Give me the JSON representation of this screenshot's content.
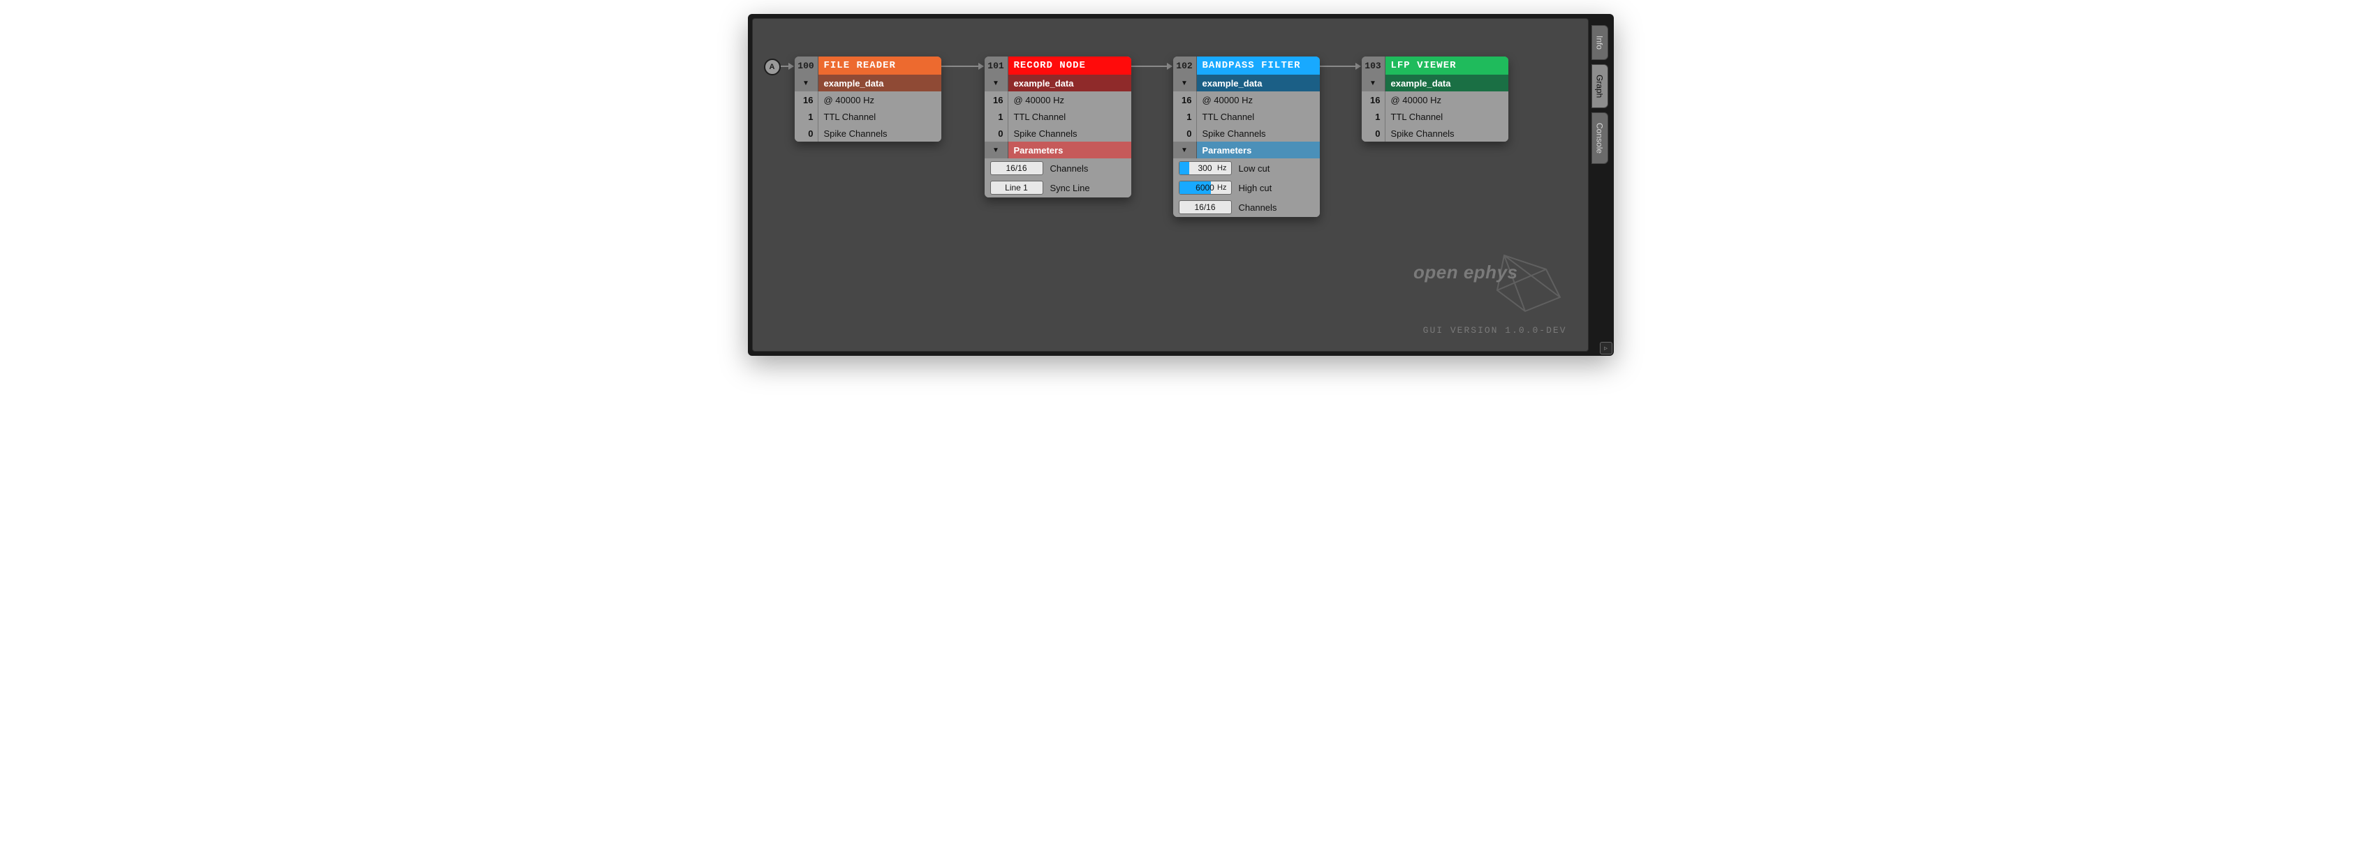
{
  "start_label": "A",
  "tabs": {
    "info": "Info",
    "graph": "Graph",
    "console": "Console"
  },
  "watermark_text": "open ephys",
  "version_text": "GUI VERSION 1.0.0-DEV",
  "nodes": [
    {
      "id": "100",
      "title": "FILE READER",
      "stream": "example_data",
      "info": [
        {
          "n": "16",
          "t": "@ 40000 Hz"
        },
        {
          "n": "1",
          "t": "TTL Channel"
        },
        {
          "n": "0",
          "t": "Spike Channels"
        }
      ]
    },
    {
      "id": "101",
      "title": "RECORD NODE",
      "stream": "example_data",
      "info": [
        {
          "n": "16",
          "t": "@ 40000 Hz"
        },
        {
          "n": "1",
          "t": "TTL Channel"
        },
        {
          "n": "0",
          "t": "Spike Channels"
        }
      ],
      "params_header": "Parameters",
      "params": [
        {
          "val": "16/16",
          "label": "Channels"
        },
        {
          "val": "Line 1",
          "label": "Sync Line"
        }
      ]
    },
    {
      "id": "102",
      "title": "BANDPASS FILTER",
      "stream": "example_data",
      "info": [
        {
          "n": "16",
          "t": "@ 40000 Hz"
        },
        {
          "n": "1",
          "t": "TTL Channel"
        },
        {
          "n": "0",
          "t": "Spike Channels"
        }
      ],
      "params_header": "Parameters",
      "params": [
        {
          "val": "300",
          "unit": "Hz",
          "fill": 20,
          "label": "Low cut"
        },
        {
          "val": "6000",
          "unit": "Hz",
          "fill": 62,
          "label": "High cut"
        },
        {
          "val": "16/16",
          "label": "Channels"
        }
      ]
    },
    {
      "id": "103",
      "title": "LFP VIEWER",
      "stream": "example_data",
      "info": [
        {
          "n": "16",
          "t": "@ 40000 Hz"
        },
        {
          "n": "1",
          "t": "TTL Channel"
        },
        {
          "n": "0",
          "t": "Spike Channels"
        }
      ]
    }
  ]
}
